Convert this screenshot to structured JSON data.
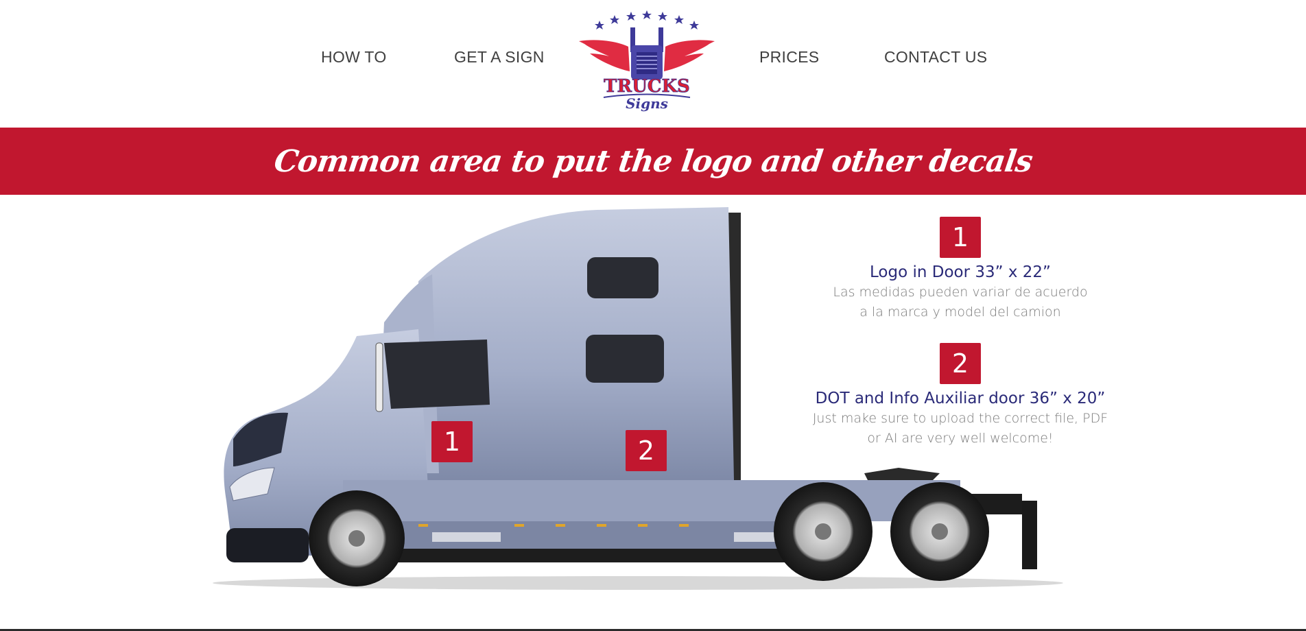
{
  "nav": {
    "left": [
      {
        "label": "HOW TO"
      },
      {
        "label": "GET A SIGN"
      }
    ],
    "right": [
      {
        "label": "PRICES"
      },
      {
        "label": "CONTACT US"
      }
    ]
  },
  "logo": {
    "main": "TRUCKS",
    "sub": "Signs",
    "icon": "winged-truck-logo"
  },
  "banner": {
    "title": "Common area to put the logo and other decals"
  },
  "areas": [
    {
      "number": "1",
      "title": "Logo in Door  33” x 22”",
      "desc_line1": "Las medidas pueden variar de acuerdo",
      "desc_line2": "a la marca y model del camion"
    },
    {
      "number": "2",
      "title": "DOT and Info Auxiliar door  36” x 20”",
      "desc_line1": "Just make sure to upload the correct file, PDF",
      "desc_line2": "or AI are very well welcome!"
    }
  ],
  "colors": {
    "accent": "#c1172f",
    "title_blue": "#2a2a78",
    "truck_body": "#a9b2cc"
  }
}
